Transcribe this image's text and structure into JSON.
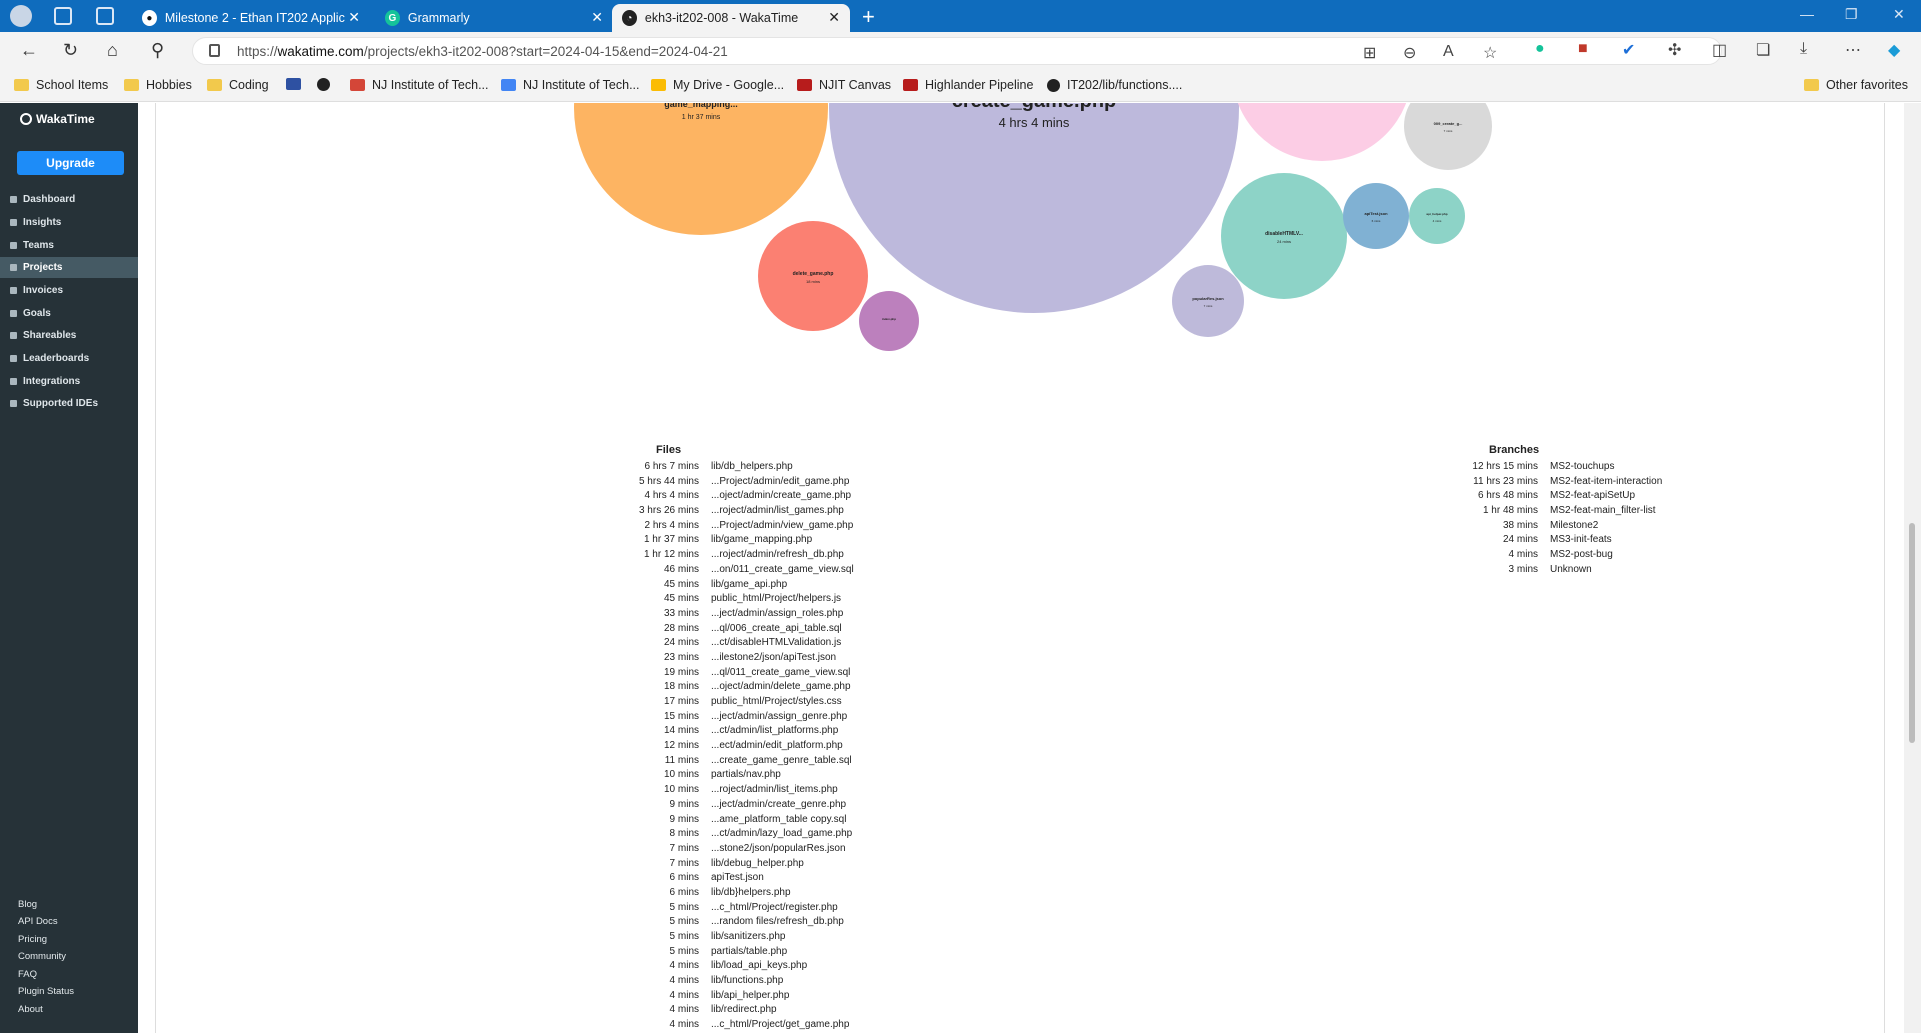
{
  "browser": {
    "tabs": [
      {
        "label": "Milestone 2 - Ethan IT202 Applic",
        "favicon": "github-icon",
        "active": false
      },
      {
        "label": "Grammarly",
        "favicon": "grammarly-icon",
        "active": false
      },
      {
        "label": "ekh3-it202-008 - WakaTime",
        "favicon": "wakatime-icon",
        "active": true
      }
    ],
    "url_prefix": "https://",
    "url_host": "wakatime.com",
    "url_path": "/projects/ekh3-it202-008?start=2024-04-15&end=2024-04-21",
    "bookmarks": [
      {
        "label": "School Items",
        "icon": "folder-icon"
      },
      {
        "label": "Hobbies",
        "icon": "folder-icon"
      },
      {
        "label": "Coding",
        "icon": "folder-icon"
      },
      {
        "label": "",
        "icon": "mal-icon"
      },
      {
        "label": "",
        "icon": "github-icon"
      },
      {
        "label": "NJ Institute of Tech...",
        "icon": "gmail-icon"
      },
      {
        "label": "NJ Institute of Tech...",
        "icon": "calendar-icon"
      },
      {
        "label": "My Drive - Google...",
        "icon": "drive-icon"
      },
      {
        "label": "NJIT Canvas",
        "icon": "njit-icon"
      },
      {
        "label": "Highlander Pipeline",
        "icon": "njit-icon"
      },
      {
        "label": "IT202/lib/functions....",
        "icon": "github-icon"
      }
    ],
    "other_favorites": "Other favorites"
  },
  "sidebar": {
    "brand": "WakaTime",
    "upgrade": "Upgrade",
    "items": [
      "Dashboard",
      "Insights",
      "Teams",
      "Projects",
      "Invoices",
      "Goals",
      "Shareables",
      "Leaderboards",
      "Integrations",
      "Supported IDEs"
    ],
    "active": "Projects",
    "footer": [
      "Blog",
      "API Docs",
      "Pricing",
      "Community",
      "FAQ",
      "Plugin Status",
      "About"
    ]
  },
  "bubble_chart": {
    "bubbles": [
      {
        "name": "create_game.php",
        "time": "4 hrs 4 mins",
        "color": "#bdb9dc"
      },
      {
        "name": "game_mapping...",
        "time": "1 hr 37 mins",
        "color": "#fdb462"
      },
      {
        "name": "delete_game.php",
        "time": "18 mins",
        "color": "#fb8072"
      },
      {
        "name": "index.php",
        "time": "",
        "color": "#bc80bd"
      },
      {
        "name": "disableHTMLV...",
        "time": "24 mins",
        "color": "#8dd3c7"
      },
      {
        "name": "popularRes.json",
        "time": "7 mins",
        "color": "#bebada"
      },
      {
        "name": "apiTest.json",
        "time": "6 mins",
        "color": "#80b1d3"
      },
      {
        "name": "api_helper.php",
        "time": "4 mins",
        "color": "#8dd3c7"
      },
      {
        "name": "009_create_g...",
        "time": "7 mins",
        "color": "#d9d9d9"
      },
      {
        "name": "",
        "time": "",
        "color": "#fccde5"
      },
      {
        "name": "",
        "time": "",
        "color": "#fdb462"
      }
    ]
  },
  "files": {
    "title": "Files",
    "rows": [
      {
        "time": "6 hrs 7 mins",
        "name": "lib/db_helpers.php"
      },
      {
        "time": "5 hrs 44 mins",
        "name": "...Project/admin/edit_game.php"
      },
      {
        "time": "4 hrs 4 mins",
        "name": "...oject/admin/create_game.php"
      },
      {
        "time": "3 hrs 26 mins",
        "name": "...roject/admin/list_games.php"
      },
      {
        "time": "2 hrs 4 mins",
        "name": "...Project/admin/view_game.php"
      },
      {
        "time": "1 hr 37 mins",
        "name": "lib/game_mapping.php"
      },
      {
        "time": "1 hr 12 mins",
        "name": "...roject/admin/refresh_db.php"
      },
      {
        "time": "46 mins",
        "name": "...on/011_create_game_view.sql"
      },
      {
        "time": "45 mins",
        "name": "lib/game_api.php"
      },
      {
        "time": "45 mins",
        "name": "public_html/Project/helpers.js"
      },
      {
        "time": "33 mins",
        "name": "...ject/admin/assign_roles.php"
      },
      {
        "time": "28 mins",
        "name": "...ql/006_create_api_table.sql"
      },
      {
        "time": "24 mins",
        "name": "...ct/disableHTMLValidation.js"
      },
      {
        "time": "23 mins",
        "name": "...ilestone2/json/apiTest.json"
      },
      {
        "time": "19 mins",
        "name": "...ql/011_create_game_view.sql"
      },
      {
        "time": "18 mins",
        "name": "...oject/admin/delete_game.php"
      },
      {
        "time": "17 mins",
        "name": "public_html/Project/styles.css"
      },
      {
        "time": "15 mins",
        "name": "...ject/admin/assign_genre.php"
      },
      {
        "time": "14 mins",
        "name": "...ct/admin/list_platforms.php"
      },
      {
        "time": "12 mins",
        "name": "...ect/admin/edit_platform.php"
      },
      {
        "time": "11 mins",
        "name": "...create_game_genre_table.sql"
      },
      {
        "time": "10 mins",
        "name": "partials/nav.php"
      },
      {
        "time": "10 mins",
        "name": "...roject/admin/list_items.php"
      },
      {
        "time": "9 mins",
        "name": "...ject/admin/create_genre.php"
      },
      {
        "time": "9 mins",
        "name": "...ame_platform_table copy.sql"
      },
      {
        "time": "8 mins",
        "name": "...ct/admin/lazy_load_game.php"
      },
      {
        "time": "7 mins",
        "name": "...stone2/json/popularRes.json"
      },
      {
        "time": "7 mins",
        "name": "lib/debug_helper.php"
      },
      {
        "time": "6 mins",
        "name": "apiTest.json"
      },
      {
        "time": "6 mins",
        "name": "lib/db}helpers.php"
      },
      {
        "time": "5 mins",
        "name": "...c_html/Project/register.php"
      },
      {
        "time": "5 mins",
        "name": "...random files/refresh_db.php"
      },
      {
        "time": "5 mins",
        "name": "lib/sanitizers.php"
      },
      {
        "time": "5 mins",
        "name": "partials/table.php"
      },
      {
        "time": "4 mins",
        "name": "lib/load_api_keys.php"
      },
      {
        "time": "4 mins",
        "name": "lib/functions.php"
      },
      {
        "time": "4 mins",
        "name": "lib/api_helper.php"
      },
      {
        "time": "4 mins",
        "name": "lib/redirect.php"
      },
      {
        "time": "4 mins",
        "name": "...c_html/Project/get_game.php"
      }
    ]
  },
  "branches": {
    "title": "Branches",
    "rows": [
      {
        "time": "12 hrs 15 mins",
        "name": "MS2-touchups"
      },
      {
        "time": "11 hrs 23 mins",
        "name": "MS2-feat-item-interaction"
      },
      {
        "time": "6 hrs 48 mins",
        "name": "MS2-feat-apiSetUp"
      },
      {
        "time": "1 hr 48 mins",
        "name": "MS2-feat-main_filter-list"
      },
      {
        "time": "38 mins",
        "name": "Milestone2"
      },
      {
        "time": "24 mins",
        "name": "MS3-init-feats"
      },
      {
        "time": "4 mins",
        "name": "MS2-post-bug"
      },
      {
        "time": "3 mins",
        "name": "Unknown"
      }
    ]
  }
}
